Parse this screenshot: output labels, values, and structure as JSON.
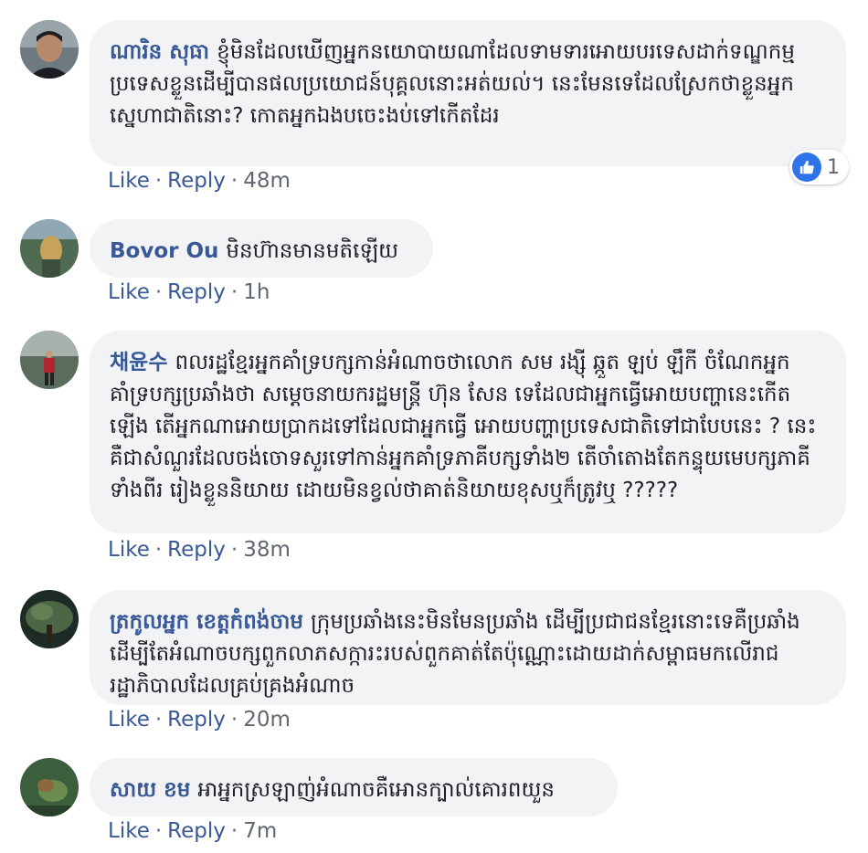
{
  "comments": [
    {
      "name": "ណារិន សុធា",
      "text": "ខ្ញុំមិនដែលឃើញអ្នកនយោបាយណាដែលទាមទារអោយបរទេសដាក់ទណ្ឌកម្មប្រទេសខ្លួនដើម្បីបានផលប្រយោជន៍បុគ្គលនោះអត់យល់។ នេះមែនទេដែលស្រែកថាខ្លួនអ្នកស្នេហាជាតិនោះ? កោតអ្នកឯងបចេះងប់ទៅកើតដែរ",
      "like": "Like",
      "reply": "Reply",
      "time": "48m",
      "reaction_count": "1"
    },
    {
      "name": "Bovor Ou",
      "text": "មិនហ៊ានមានមតិឡើយ",
      "like": "Like",
      "reply": "Reply",
      "time": "1h"
    },
    {
      "name": "채윤수",
      "text": "ពលរដ្ឋខ្មែរអ្នកគាំទ្របក្សកាន់អំណាចថាលោក សម រង្ស៊ី ឆ្កួត ឡប់ ឡឹកី ចំណែកអ្នកគាំទ្របក្សប្រឆាំងថា សម្ដេចនាយករដ្ឋមន្ត្រី ហ៊ុន សែន ទេដែលជាអ្នកធ្វើអោយបញ្ហានេះកើតឡើង តើអ្នកណាអោយប្រាកដទៅដែលជាអ្នកធ្វើ អោយបញ្ហាប្រទេសជាតិទៅជាបែបនេះ ? នេះគឺជាសំណួរដែលចង់ចោទសួរទៅកាន់អ្នកគាំទ្រភាគីបក្សទាំង២ តើចាំតោងតែកន្ទុយមេបក្សភាគីទាំងពីរ រៀងខ្លួននិយាយ ដោយមិនខ្វល់ថាគាត់និយាយខុសឬក៏ត្រូវឬ ?????",
      "like": "Like",
      "reply": "Reply",
      "time": "38m"
    },
    {
      "name": "ត្រកូលអ្នក ខេត្តកំពង់ចាម",
      "text": "ក្រុមប្រឆាំងនេះមិនមែនប្រឆាំង ដើម្បីប្រជាជនខ្មែរនោះទេគឺប្រឆាំងដើម្បីតែអំណាចបក្សពួកលាភសក្ការះរបស់ពួកគាត់តែប៉ុណ្ណោះដោយដាក់សម្ពាធមកលើរាជរដ្ឋាភិបាលដែលគ្រប់គ្រងអំណាច",
      "like": "Like",
      "reply": "Reply",
      "time": "20m"
    },
    {
      "name": "សាយ ខម",
      "text": "អាអ្នកស្រឡាញ់អំណាចគឺអោនក្បាល់គោរពយួន",
      "like": "Like",
      "reply": "Reply",
      "time": "7m"
    }
  ],
  "colors": {
    "name": "#385898",
    "bubble": "#f2f3f5",
    "meta": "#606770",
    "like_badge": "#2f73ea"
  }
}
